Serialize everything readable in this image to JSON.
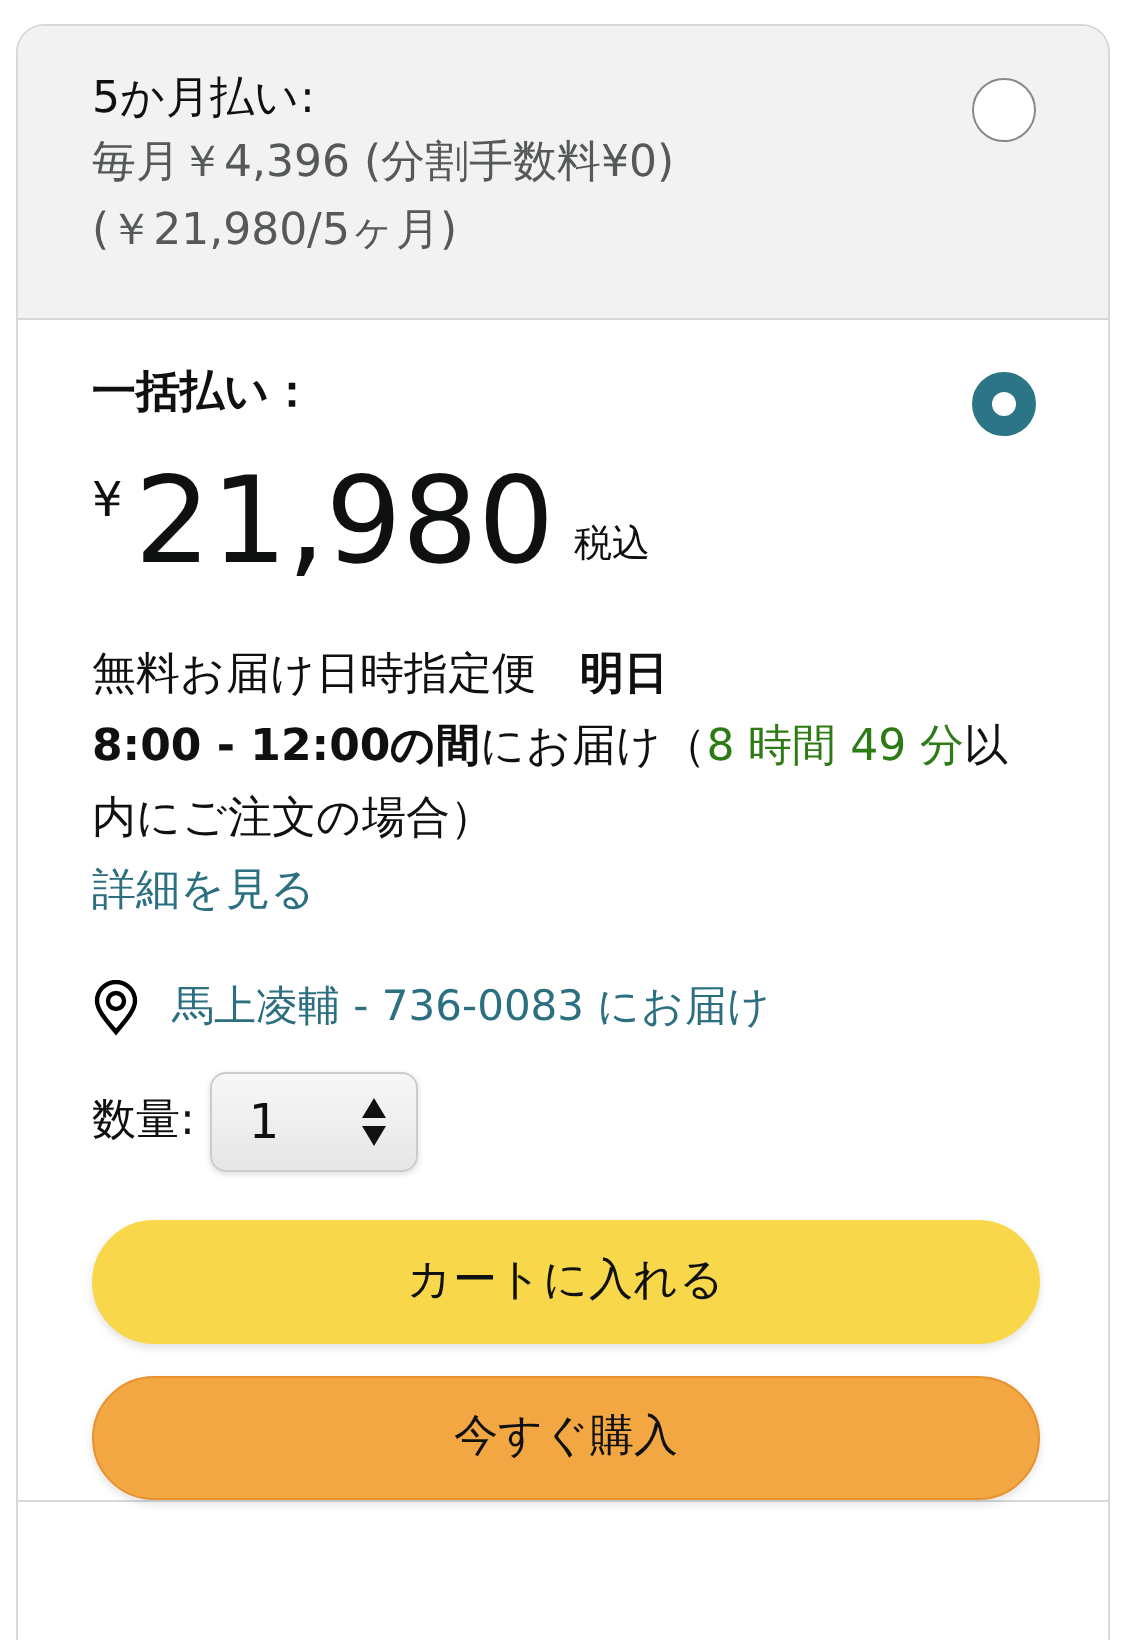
{
  "options": [
    {
      "title": "5か月払い:",
      "selected": false,
      "lines": [
        "毎月￥4,396 (分割手数料¥0)",
        "(￥21,980/5ヶ月)"
      ]
    },
    {
      "title": "一括払い：",
      "selected": true,
      "price": {
        "currency": "¥",
        "amount": "21,980",
        "tax_note": "税込"
      },
      "delivery": [
        [
          {
            "kind": "normal",
            "text": "無料お届け日時指定便　"
          },
          {
            "kind": "bold",
            "text": "明日"
          }
        ],
        [
          {
            "kind": "bold",
            "text": "8:00 - 12:00の間"
          },
          {
            "kind": "normal",
            "text": "にお届け（"
          },
          {
            "kind": "green",
            "text": "8 時間 49 分"
          },
          {
            "kind": "normal",
            "text": "以内にご注文の場合）"
          }
        ]
      ],
      "details_link": "詳細を見る",
      "address": "馬上凌輔 - 736-0083 にお届け",
      "quantity": {
        "label": "数量:",
        "value": "1"
      },
      "buttons": [
        {
          "kind": "cart",
          "label": "カートに入れる"
        },
        {
          "kind": "buy",
          "label": "今すぐ購入"
        }
      ]
    }
  ]
}
